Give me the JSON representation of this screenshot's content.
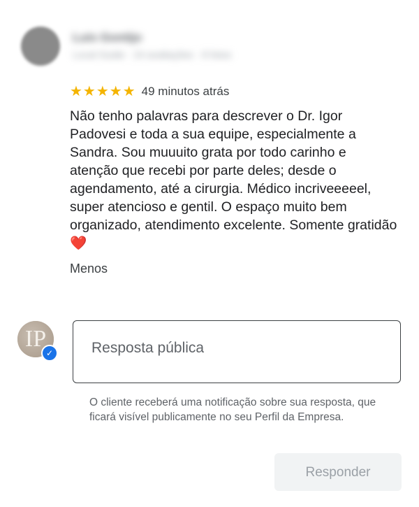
{
  "reviewer": {
    "name": "Luis Gontijo",
    "meta": "Local Guide · 24 avaliações · 8 fotos"
  },
  "review": {
    "rating": 5,
    "stars": "★★★★★",
    "time": "49 minutos atrás",
    "text": "Não tenho palavras para descrever o Dr. Igor Padovesi e toda a sua equipe, especialmente a Sandra. Sou muuuito grata por todo carinho e atenção que recebi por parte deles; desde o agendamento, até a cirurgia. Médico incriveeeeel, super atencioso e gentil. O espaço muito bem organizado, atendimento excelente. Somente gratidão",
    "heart": "❤️",
    "less_label": "Menos"
  },
  "owner": {
    "monogram": "IP",
    "verified_icon": "check-badge-icon"
  },
  "reply": {
    "placeholder": "Resposta pública",
    "notice": "O cliente receberá uma notificação sobre sua resposta, que ficará visível publicamente no seu Perfil da Empresa.",
    "button_label": "Responder"
  },
  "colors": {
    "star": "#f4b400",
    "verified": "#1a73e8",
    "heart": "#e0262e"
  }
}
